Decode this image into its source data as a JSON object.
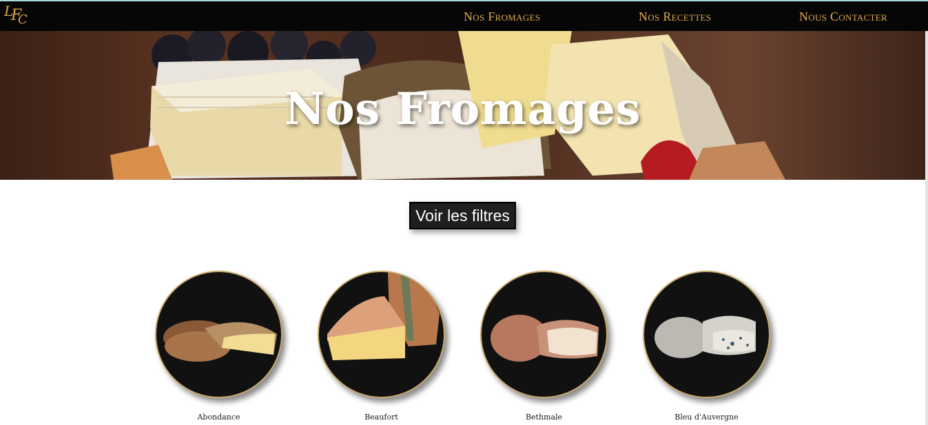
{
  "navbar": {
    "logo_letters": [
      "L",
      "F",
      "C"
    ],
    "links": [
      {
        "label": "Nos Fromages"
      },
      {
        "label": "Nos Recettes"
      },
      {
        "label": "Nous Contacter"
      }
    ]
  },
  "hero": {
    "title": "Nos Fromages"
  },
  "filters": {
    "button_label": "Voir les filtres"
  },
  "cheeses": [
    {
      "name": "Abondance"
    },
    {
      "name": "Beaufort"
    },
    {
      "name": "Bethmale"
    },
    {
      "name": "Bleu d'Auvergne"
    }
  ],
  "colors": {
    "navbar_bg": "#060606",
    "nav_link": "#e0ac4d",
    "button_bg": "#1f1f1f",
    "circle_border": "#c9a96a"
  }
}
